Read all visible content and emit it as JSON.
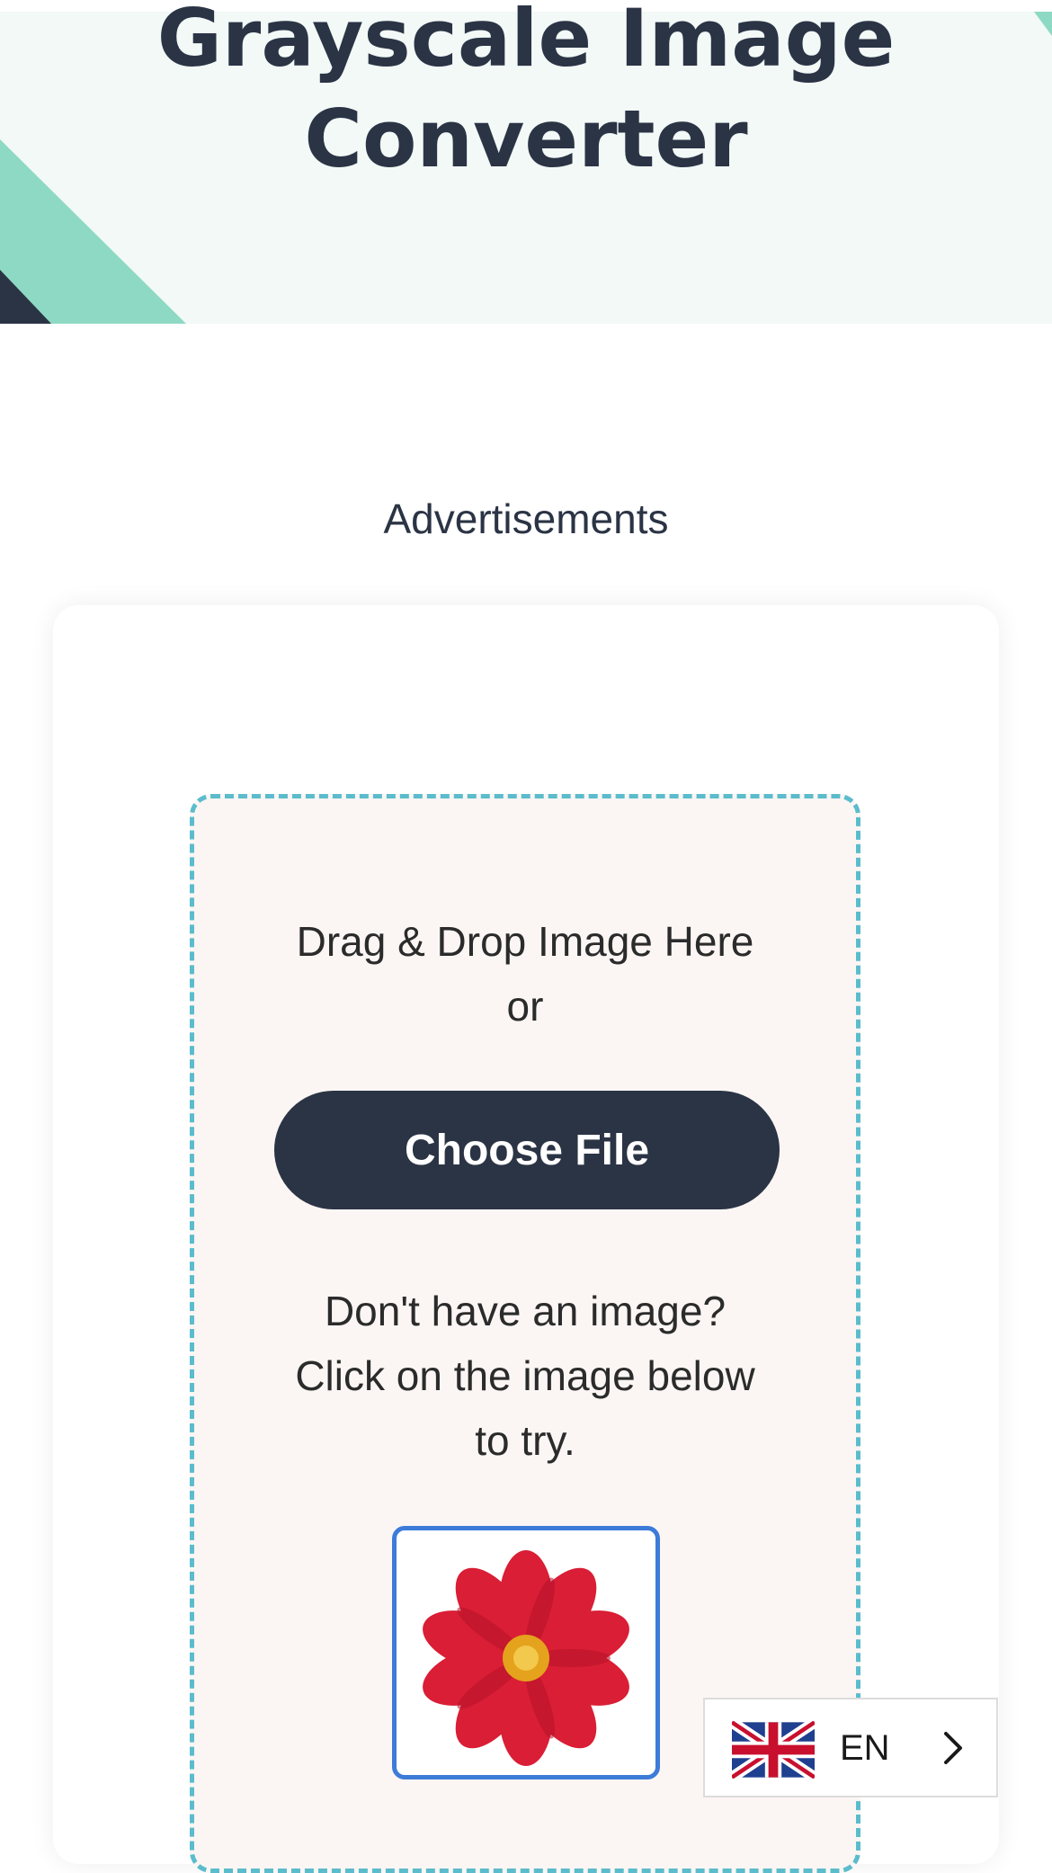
{
  "hero": {
    "title_line1": "Grayscale Image",
    "title_line2": "Converter"
  },
  "ads": {
    "label": "Advertisements"
  },
  "upload": {
    "drag_text": "Drag & Drop Image Here",
    "or_text": "or",
    "choose_button": "Choose File",
    "hint_line1": "Don't have an image?",
    "hint_line2": "Click on the image below",
    "hint_line3": "to try.",
    "sample_image_icon": "red-flower-sample"
  },
  "language": {
    "flag_icon": "uk-flag-icon",
    "code": "EN",
    "chevron_icon": "chevron-right-icon"
  },
  "colors": {
    "primary_dark": "#2b3445",
    "hero_bg": "#f2f9f7",
    "accent_mint": "#8ed9c3",
    "dropzone_border": "#5bbccc",
    "dropzone_bg": "#fbf6f4",
    "sample_border": "#3d7bd9"
  }
}
